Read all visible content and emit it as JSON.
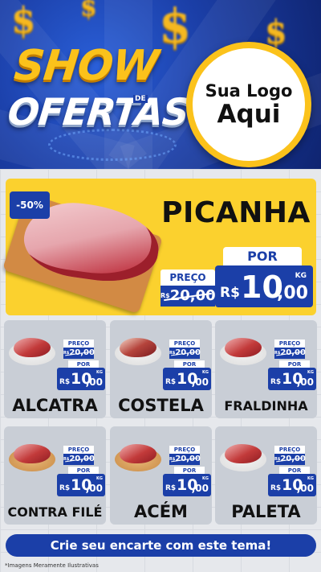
{
  "header": {
    "title_line1": "SHOW",
    "title_de": "DE",
    "title_line2": "OFERTAS",
    "logo_line1": "Sua Logo",
    "logo_line2": "Aqui",
    "dollar_symbol": "$"
  },
  "colors": {
    "blue": "#1b3fa8",
    "yellow": "#fbd12e",
    "gold": "#fbc21b"
  },
  "featured": {
    "name": "PICANHA",
    "discount": "-50%",
    "preco_label": "PREÇO",
    "old_currency": "R$",
    "old_price": "20,00",
    "por_label": "POR",
    "currency": "R$",
    "price_int": "10",
    "price_dec": ",00",
    "unit": "KG"
  },
  "products": [
    {
      "name": "ALCATRA",
      "preco_label": "PREÇO",
      "old_currency": "R$",
      "old_price": "20,00",
      "por_label": "POR",
      "currency": "R$",
      "price_int": "10",
      "price_dec": ",00",
      "unit": "KG"
    },
    {
      "name": "COSTELA",
      "preco_label": "PREÇO",
      "old_currency": "R$",
      "old_price": "20,00",
      "por_label": "POR",
      "currency": "R$",
      "price_int": "10",
      "price_dec": ",00",
      "unit": "KG"
    },
    {
      "name": "FRALDINHA",
      "preco_label": "PREÇO",
      "old_currency": "R$",
      "old_price": "20,00",
      "por_label": "POR",
      "currency": "R$",
      "price_int": "10",
      "price_dec": ",00",
      "unit": "KG"
    },
    {
      "name": "CONTRA FILÉ",
      "preco_label": "PREÇO",
      "old_currency": "R$",
      "old_price": "20,00",
      "por_label": "POR",
      "currency": "R$",
      "price_int": "10",
      "price_dec": ",00",
      "unit": "KG"
    },
    {
      "name": "ACÉM",
      "preco_label": "PREÇO",
      "old_currency": "R$",
      "old_price": "20,00",
      "por_label": "POR",
      "currency": "R$",
      "price_int": "10",
      "price_dec": ",00",
      "unit": "KG"
    },
    {
      "name": "PALETA",
      "preco_label": "PREÇO",
      "old_currency": "R$",
      "old_price": "20,00",
      "por_label": "POR",
      "currency": "R$",
      "price_int": "10",
      "price_dec": ",00",
      "unit": "KG"
    }
  ],
  "footer": {
    "cta": "Crie seu encarte com este tema!",
    "disclaimer": "*Imagens Meramente Ilustrativas"
  }
}
